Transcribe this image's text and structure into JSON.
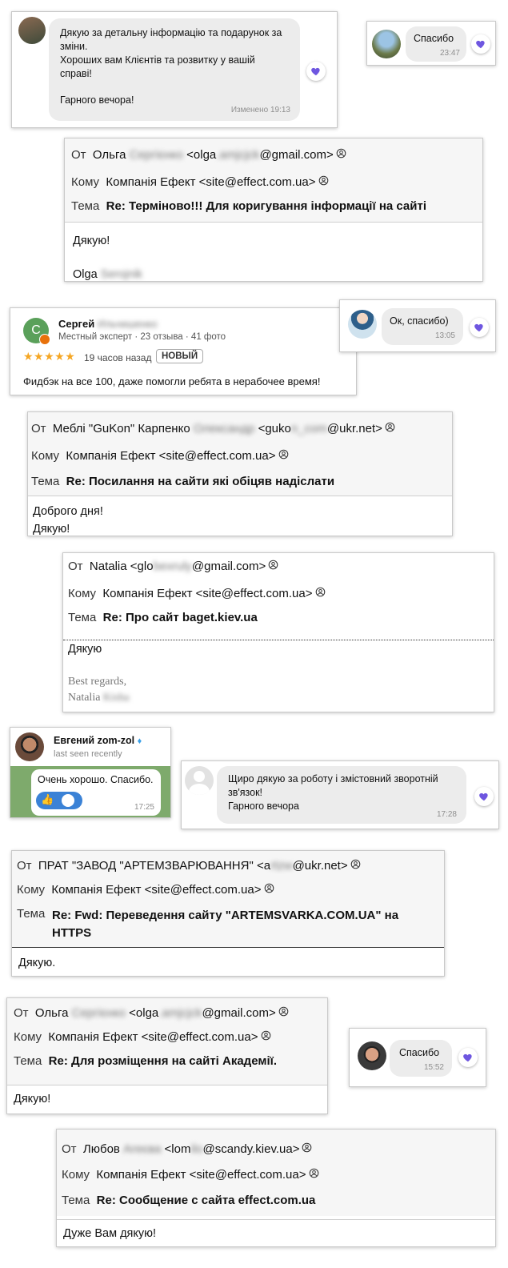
{
  "chat1": {
    "text": "Дякую за детальну інформацію та подарунок за зміни.\nХороших вам Клієнтів та розвитку у вашій справі!\n\nГарного вечора!",
    "time": "Изменено 19:13"
  },
  "chat2": {
    "text": "Спасибо",
    "time": "23:47"
  },
  "mail1": {
    "from_label": "От",
    "from_name": "Ольга",
    "from_blur": "Сергієнко",
    "from_email_a": "<olga",
    "from_email_blur": ".amjcjck",
    "from_email_b": "@gmail.com>",
    "to_label": "Кому",
    "to": "Компанія Ефект <site@effect.com.ua>",
    "subj_label": "Тема",
    "subject": "Re: Терміново!!! Для коригування інформації на сайті",
    "body": "Дякую!",
    "sign": "Olga",
    "sign_blur": "Serojnik"
  },
  "review": {
    "avatar_letter": "С",
    "name": "Сергей",
    "name_blur": "Ильчишенко",
    "meta": "Местный эксперт · 23 отзыва · 41 фото",
    "stars": "★★★★★",
    "rating": 5,
    "ago": "19 часов назад",
    "badge": "НОВЫЙ",
    "text": "Фидбэк на все 100, даже помогли ребята в нерабочее время!"
  },
  "chat3": {
    "text": "Ок, спасибо)",
    "time": "13:05"
  },
  "mail2": {
    "from_label": "От",
    "from_name": "Меблі \"GuKon\" Карпенко",
    "from_blur": "Олександр",
    "from_email_a": "<guko",
    "from_email_blur": "n_com",
    "from_email_b": "@ukr.net>",
    "to_label": "Кому",
    "to": "Компанія Ефект <site@effect.com.ua>",
    "subj_label": "Тема",
    "subject": "Re: Посилання на сайти які обіцяв надіслати",
    "body": "Доброго дня!\nДякую!"
  },
  "mail3": {
    "from_label": "От",
    "from_name": "Natalia",
    "from_email_a": "<glo",
    "from_email_blur": "bexruly",
    "from_email_b": "@gmail.com>",
    "to_label": "Кому",
    "to": "Компанія Ефект <site@effect.com.ua>",
    "subj_label": "Тема",
    "subject": "Re: Про сайт baget.kiev.ua",
    "body": "Дякую",
    "regards": "Best regards,",
    "sign": "Natalia",
    "sign_blur": "Kisha"
  },
  "tg": {
    "name": "Евгений zom-zol",
    "status": "last seen recently",
    "text": "Очень хорошо. Спасибо.",
    "reaction": "👍",
    "time": "17:25"
  },
  "chat4": {
    "text": "Щиро дякую за роботу і змістовний зворотній зв'язок!\nГарного вечора",
    "time": "17:28"
  },
  "mail4": {
    "from_label": "От",
    "from_name": "ПРАТ \"ЗАВОД \"АРТЕМЗВАРЮВАННЯ\"",
    "from_email_a": "<a",
    "from_email_blur": "rtzw",
    "from_email_b": "@ukr.net>",
    "to_label": "Кому",
    "to": "Компанія Ефект <site@effect.com.ua>",
    "subj_label": "Тема",
    "subject": "Re: Fwd: Переведення сайту \"ARTEMSVARKA.COM.UA\" на HTTPS",
    "body": "Дякую."
  },
  "mail5": {
    "from_label": "От",
    "from_name": "Ольга",
    "from_blur": "Сергієнко",
    "from_email_a": "<olga",
    "from_email_blur": ".amjcjck",
    "from_email_b": "@gmail.com>",
    "to_label": "Кому",
    "to": "Компанія Ефект <site@effect.com.ua>",
    "subj_label": "Тема",
    "subject": "Re: Для розміщення на сайті Академії.",
    "body": "Дякую!"
  },
  "chat5": {
    "text": "Спасибо",
    "time": "15:52"
  },
  "mail6": {
    "from_label": "От",
    "from_name": "Любов",
    "from_blur": "Агеєва",
    "from_email_a": "<lom",
    "from_email_blur": "ilo",
    "from_email_b": "@scandy.kiev.ua>",
    "to_label": "Кому",
    "to": "Компанія Ефект <site@effect.com.ua>",
    "subj_label": "Тема",
    "subject": "Re: Сообщение с сайта effect.com.ua",
    "body": "Дуже Вам дякую!"
  },
  "colors": {
    "heart": "#6e56e0",
    "star": "#f5a623",
    "tg_bg": "#7eaa6c"
  }
}
